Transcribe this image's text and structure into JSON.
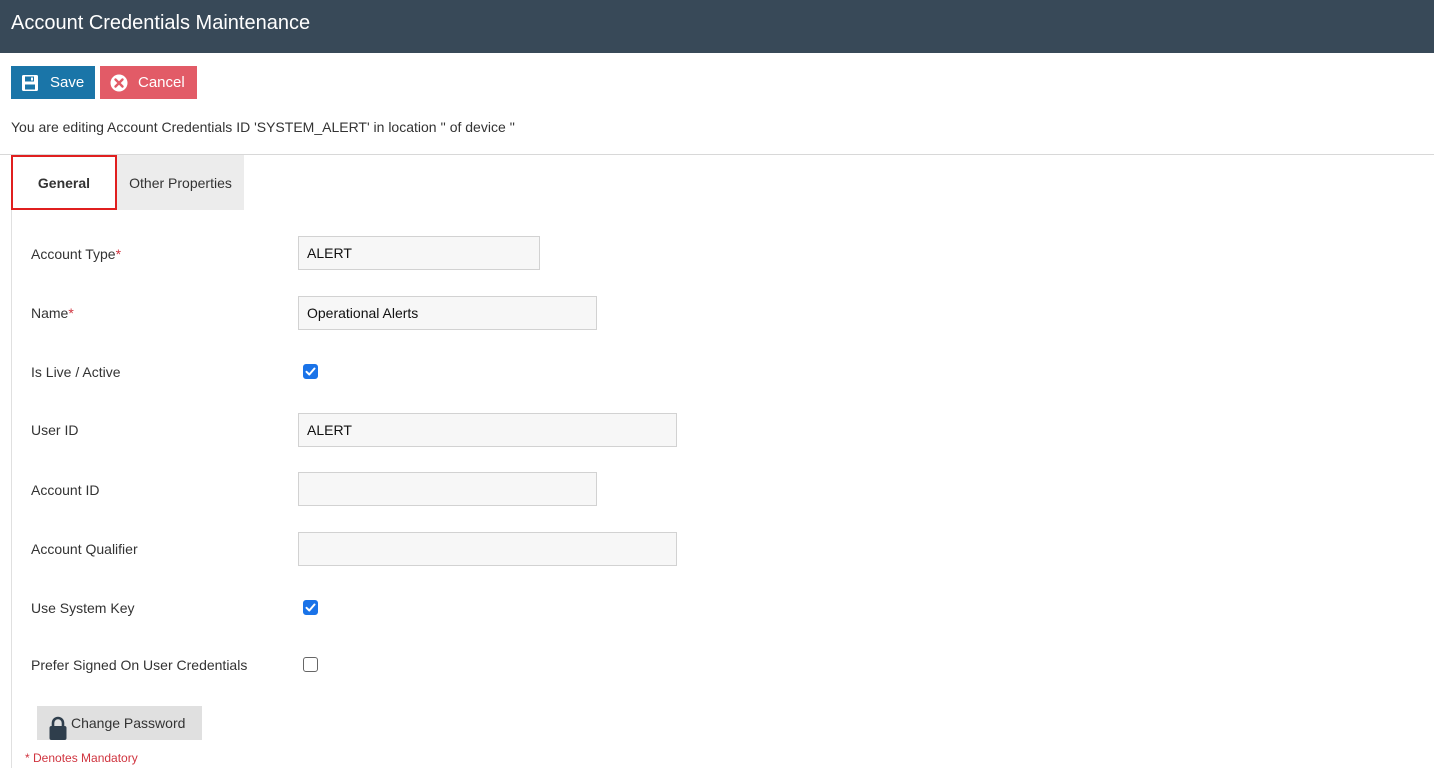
{
  "window": {
    "title": "Account Credentials Maintenance"
  },
  "toolbar": {
    "save_label": "Save",
    "cancel_label": "Cancel",
    "save_icon": "floppy-disk-icon",
    "cancel_icon": "close-circle-icon"
  },
  "info_text": "You are editing Account Credentials ID 'SYSTEM_ALERT' in location '' of device ''",
  "tabs": [
    {
      "label": "General",
      "active": true
    },
    {
      "label": "Other Properties",
      "active": false
    }
  ],
  "form": {
    "account_type": {
      "label": "Account Type",
      "required_mark": "*",
      "value": "ALERT"
    },
    "name": {
      "label": "Name",
      "required_mark": "*",
      "value": "Operational Alerts"
    },
    "is_live": {
      "label": "Is Live / Active",
      "checked": true
    },
    "user_id": {
      "label": "User ID",
      "value": "ALERT"
    },
    "account_id": {
      "label": "Account ID",
      "value": ""
    },
    "account_qualifier": {
      "label": "Account Qualifier",
      "value": ""
    },
    "use_system_key": {
      "label": "Use System Key",
      "checked": true
    },
    "prefer_signed_on": {
      "label": "Prefer Signed On User Credentials",
      "checked": false
    }
  },
  "change_password": {
    "label": "Change Password",
    "icon": "lock-icon"
  },
  "footer_note": "* Denotes Mandatory",
  "colors": {
    "titlebar": "#384958",
    "save_button": "#1a75a8",
    "cancel_button": "#e25b67",
    "active_tab_outline": "#e01f1f",
    "required_mark": "#d0343f",
    "checkbox_checked": "#1a73e8"
  }
}
